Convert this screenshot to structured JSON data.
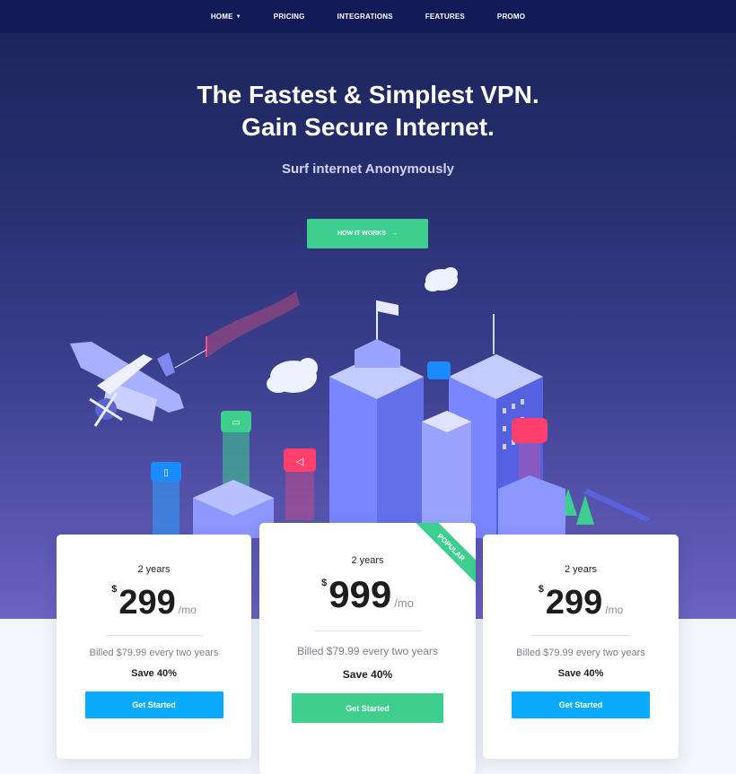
{
  "nav": {
    "items": [
      {
        "label": "HOME",
        "dropdown": true
      },
      {
        "label": "PRICING"
      },
      {
        "label": "INTEGRATIONS"
      },
      {
        "label": "FEATURES"
      },
      {
        "label": "PROMO"
      }
    ]
  },
  "hero": {
    "title_line1": "The Fastest & Simplest VPN.",
    "title_line2": "Gain Secure Internet.",
    "subtitle": "Surf internet Anonymously",
    "cta_label": "HOW IT WORKS",
    "cta_icon": "arrow-right-icon"
  },
  "pricing": {
    "plans": [
      {
        "term": "2 years",
        "currency": "$",
        "price": "299",
        "period": "/mo",
        "billed": "Billed $79.99 every two years",
        "save": "Save 40%",
        "button": "Get Started",
        "popular": false
      },
      {
        "term": "2 years",
        "currency": "$",
        "price": "999",
        "period": "/mo",
        "billed": "Billed $79.99 every two years",
        "save": "Save 40%",
        "button": "Get Started",
        "popular": true,
        "ribbon": "POPULAR"
      },
      {
        "term": "2 years",
        "currency": "$",
        "price": "299",
        "period": "/mo",
        "billed": "Billed $79.99 every two years",
        "save": "Save 40%",
        "button": "Get Started",
        "popular": false
      }
    ]
  },
  "colors": {
    "nav_bg": "#121b58",
    "accent_green": "#3ecf8e",
    "accent_blue": "#0aabff"
  }
}
